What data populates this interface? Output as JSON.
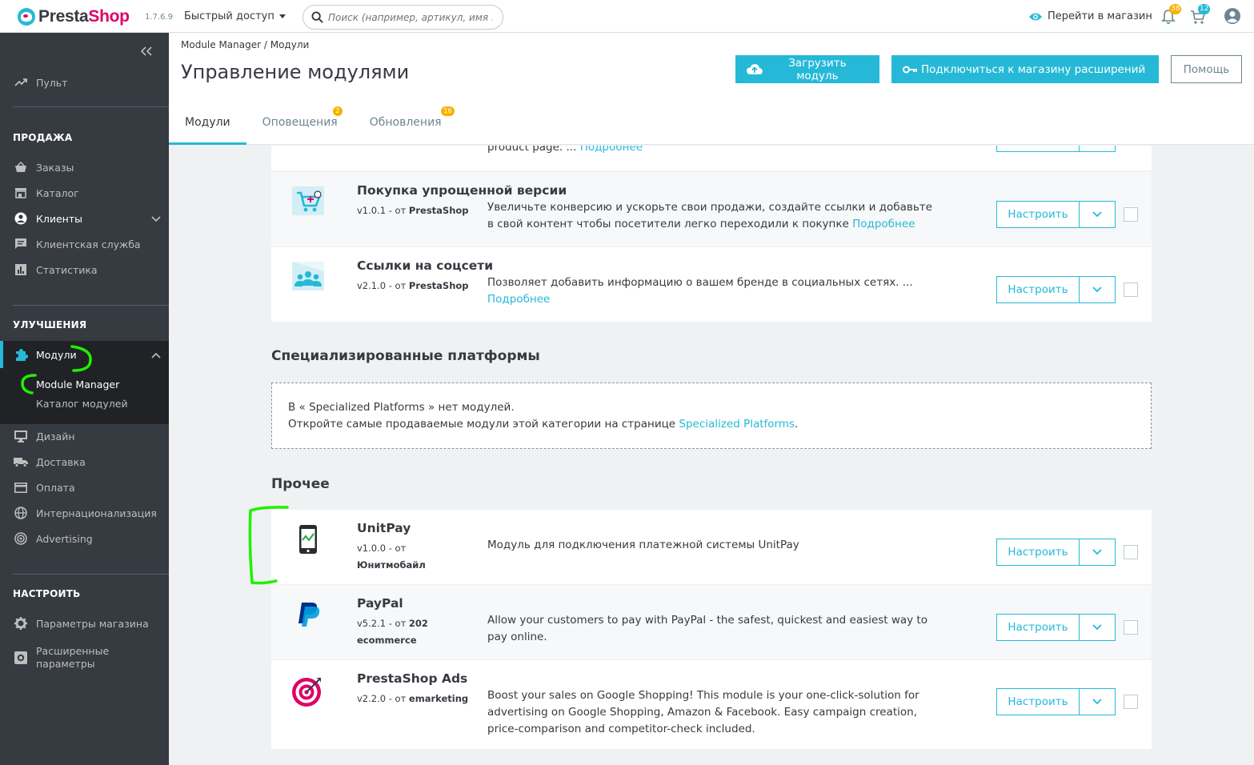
{
  "header": {
    "logo_text_a": "Presta",
    "logo_text_b": "Shop",
    "version": "1.7.6.9",
    "quick_access": "Быстрый доступ",
    "search_placeholder": "Поиск (например, артикул, имя поль:",
    "goto_shop": "Перейти в магазин",
    "notifications_count": "38",
    "cart_count": "12"
  },
  "sidebar": {
    "dashboard": "Пульт",
    "sections": {
      "sell": "ПРОДАЖА",
      "improve": "УЛУЧШЕНИЯ",
      "configure": "НАСТРОИТЬ"
    },
    "sell_items": [
      "Заказы",
      "Каталог",
      "Клиенты",
      "Клиентская служба",
      "Статистика"
    ],
    "modules": "Модули",
    "module_sub": [
      "Module Manager",
      "Каталог модулей"
    ],
    "improve_items": [
      "Дизайн",
      "Доставка",
      "Оплата",
      "Интернационализация",
      "Advertising"
    ],
    "configure_items": [
      "Параметры магазина",
      "Расширенные\nпараметры"
    ],
    "advanced_line1": "Расширенные",
    "advanced_line2": "параметры"
  },
  "pagehead": {
    "breadcrumb": "Module Manager  /  Модули",
    "title": "Управление модулями",
    "upload_btn": "Загрузить модуль",
    "connect_btn": "Подключиться к магазину расширений",
    "help_btn": "Помощь",
    "tabs": [
      {
        "label": "Модули",
        "badge": ""
      },
      {
        "label": "Оповещения",
        "badge": "2"
      },
      {
        "label": "Обновления",
        "badge": "16"
      }
    ]
  },
  "content": {
    "partial_desc": "product page. ...",
    "more_link": "Подробнее",
    "configure_label": "Настроить",
    "modules_top": [
      {
        "name": "Покупка упрощенной версии",
        "version": "v1.0.1 - от",
        "author": "PrestaShop",
        "desc": "Увеличьте конверсию и ускорьте свои продажи, создайте ссылки и добавьте в свой контент чтобы посетители легко переходили к покупке"
      },
      {
        "name": "Ссылки на соцсети",
        "version": "v2.1.0 - от",
        "author": "PrestaShop",
        "desc": "Позволяет добавить информацию о вашем бренде в социальных сетях. ..."
      }
    ],
    "specialized_title": "Специализированные платформы",
    "specialized_empty_line1": "В « Specialized Platforms » нет модулей.",
    "specialized_empty_line2": "Откройте самые продаваемые модули этой категории на странице",
    "specialized_link": "Specialized Platforms",
    "other_title": "Прочее",
    "modules_other": [
      {
        "name": "UnitPay",
        "version": "v1.0.0 - от",
        "author": "Юнитмобайл",
        "desc": "Модуль для подключения платежной системы UnitPay"
      },
      {
        "name": "PayPal",
        "version": "v5.2.1 - от",
        "author": "202 ecommerce",
        "desc": "Allow your customers to pay with PayPal - the safest, quickest and easiest way to pay online."
      },
      {
        "name": "PrestaShop Ads",
        "version": "v2.2.0 - от",
        "author": "emarketing",
        "desc": "Boost your sales on Google Shopping! This module is your one-click-solution for advertising on Google Shopping, Amazon & Facebook. Easy campaign creation, price-comparison and competitor-check included."
      }
    ]
  },
  "colors": {
    "accent": "#25b9d7",
    "brand_pink": "#df0067",
    "sidebar_bg": "#363a41",
    "badge_orange": "#fab000",
    "annotation_green": "#21f000"
  }
}
